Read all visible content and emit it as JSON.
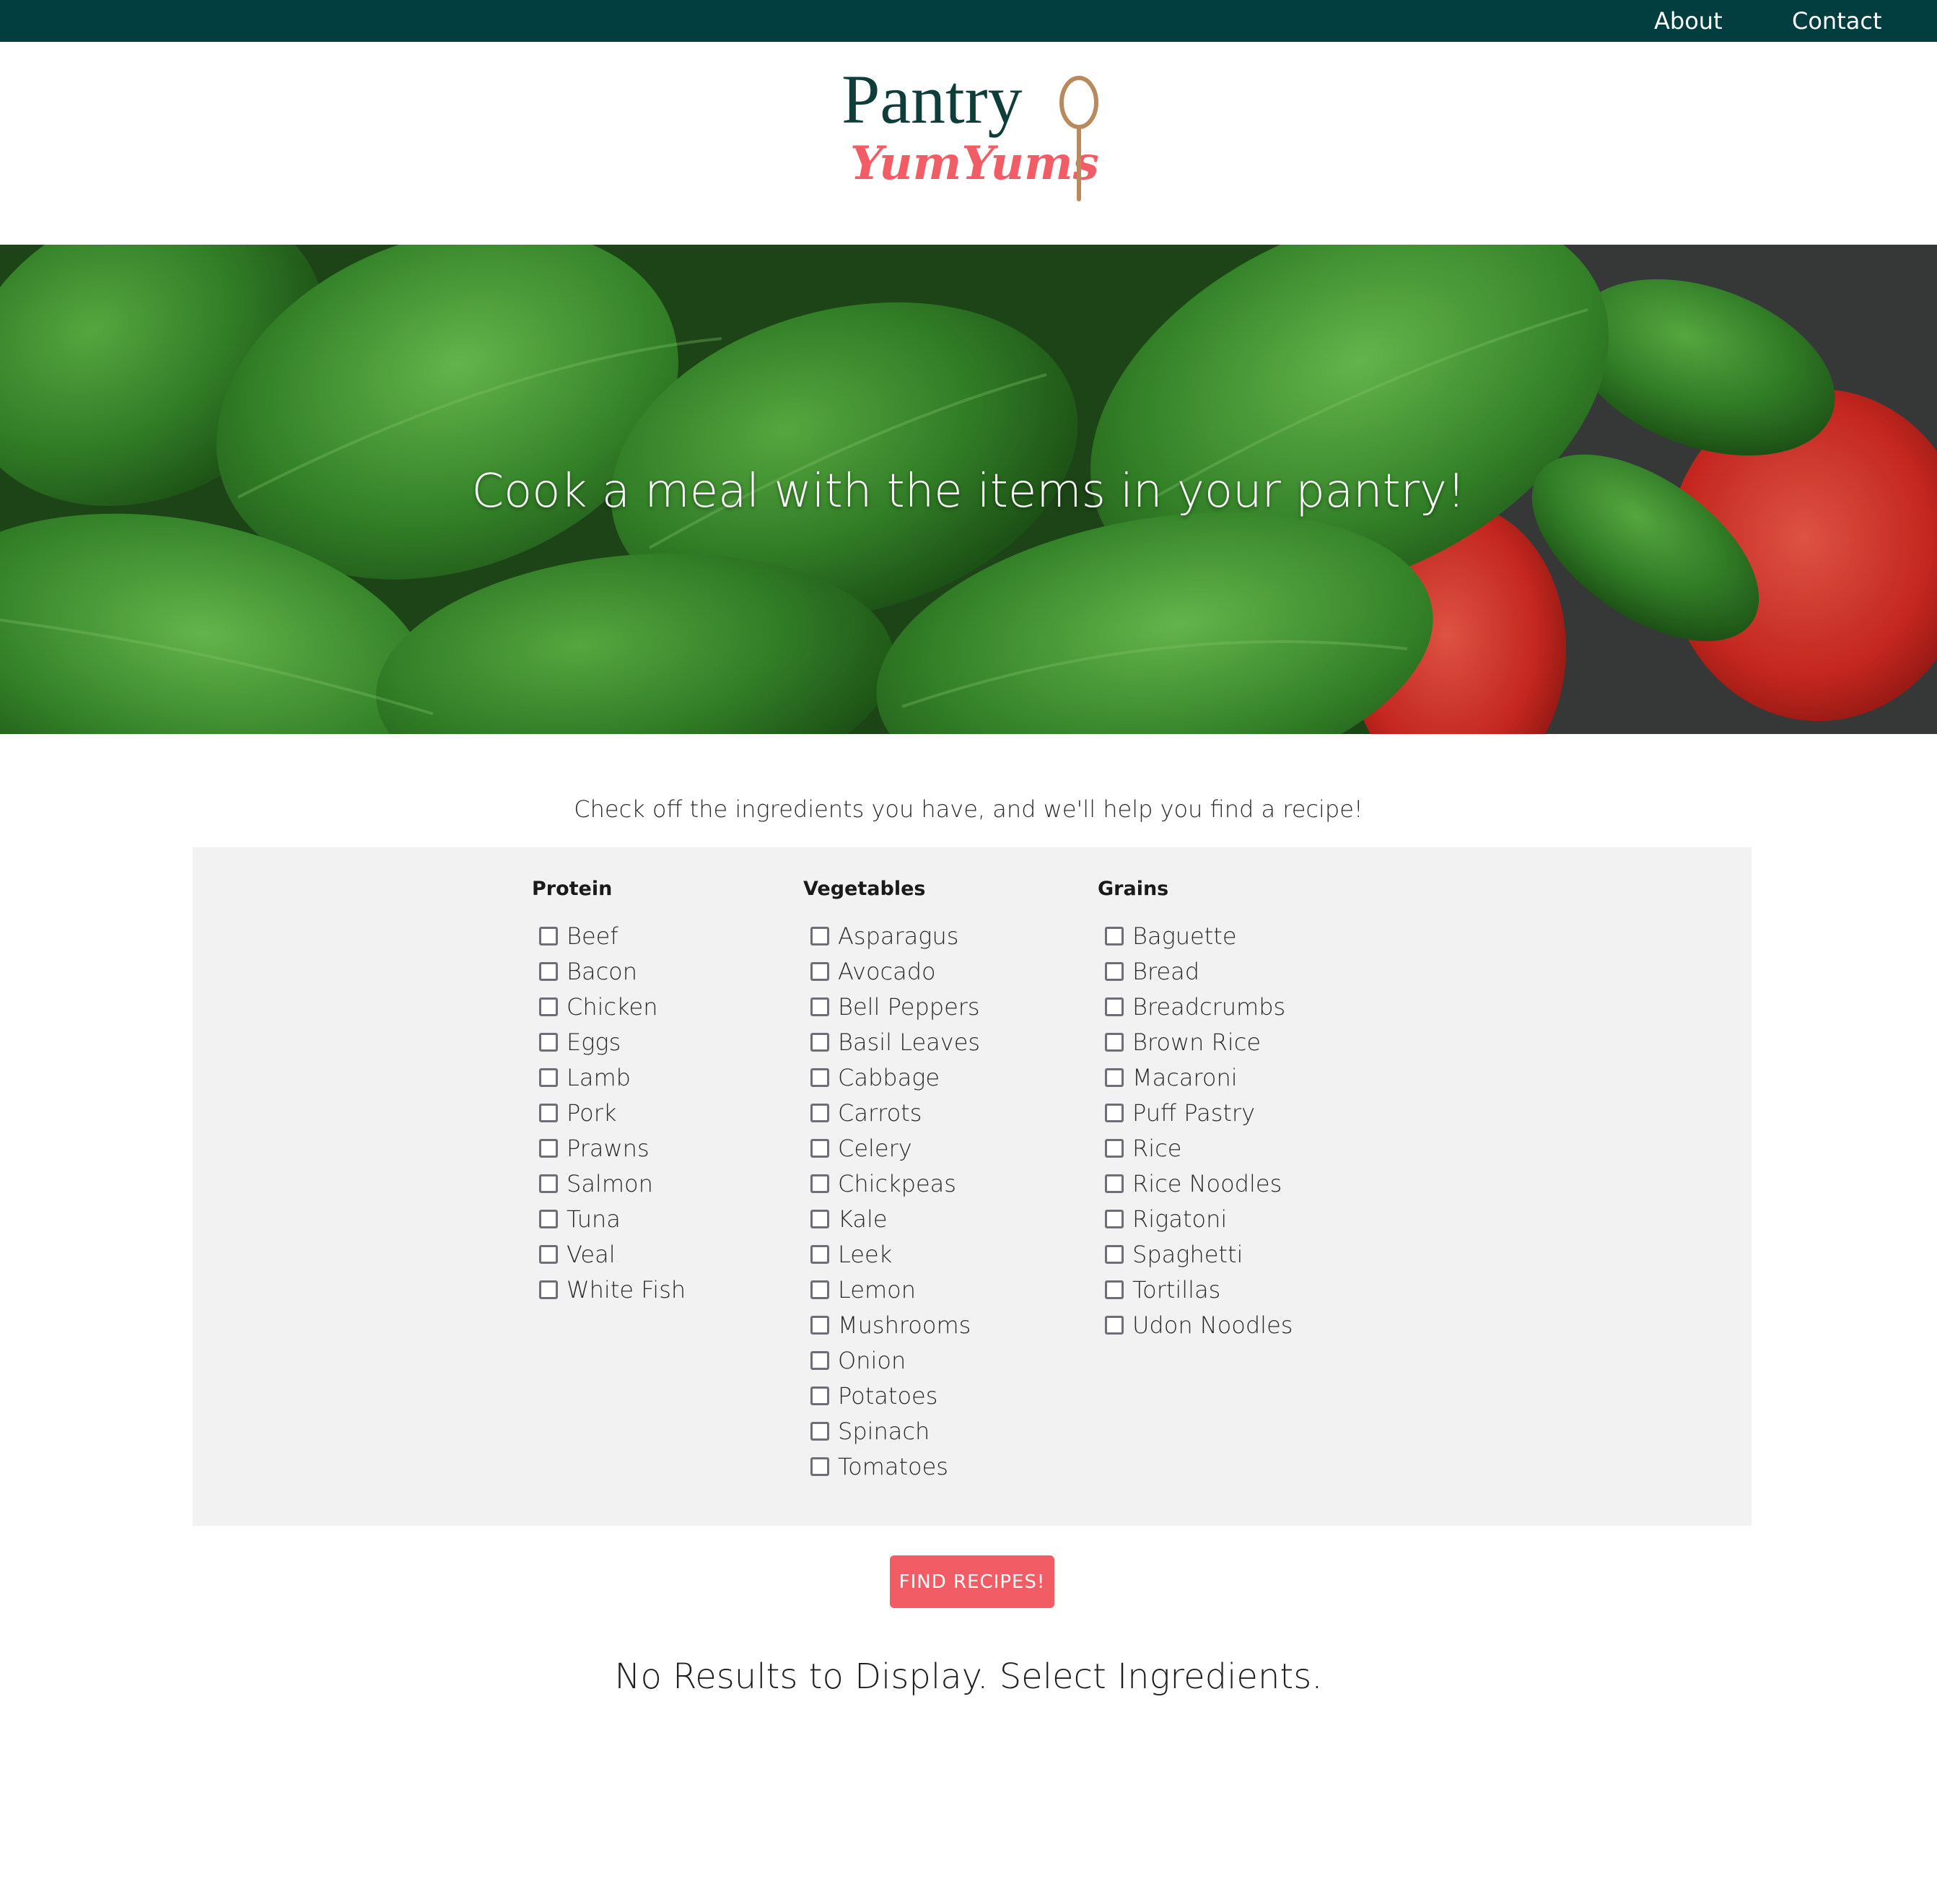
{
  "nav": {
    "about": "About",
    "contact": "Contact"
  },
  "logo": {
    "line1": "Pantry",
    "line2": "YumYums",
    "icon": "spoon-icon"
  },
  "hero": {
    "title": "Cook a meal with the items in your pantry!"
  },
  "instructions": "Check off the ingredients you have, and we'll help you find a recipe!",
  "categories": {
    "protein": {
      "heading": "Protein",
      "items": [
        "Beef",
        "Bacon",
        "Chicken",
        "Eggs",
        "Lamb",
        "Pork",
        "Prawns",
        "Salmon",
        "Tuna",
        "Veal",
        "White Fish"
      ]
    },
    "vegetables": {
      "heading": "Vegetables",
      "items": [
        "Asparagus",
        "Avocado",
        "Bell Peppers",
        "Basil Leaves",
        "Cabbage",
        "Carrots",
        "Celery",
        "Chickpeas",
        "Kale",
        "Leek",
        "Lemon",
        "Mushrooms",
        "Onion",
        "Potatoes",
        "Spinach",
        "Tomatoes"
      ]
    },
    "grains": {
      "heading": "Grains",
      "items": [
        "Baguette",
        "Bread",
        "Breadcrumbs",
        "Brown Rice",
        "Macaroni",
        "Puff Pastry",
        "Rice",
        "Rice Noodles",
        "Rigatoni",
        "Spaghetti",
        "Tortillas",
        "Udon Noodles"
      ]
    }
  },
  "find_button": "FIND RECIPES!",
  "no_results": "No Results to Display. Select Ingredients.",
  "colors": {
    "nav_bg": "#023d40",
    "logo_dark": "#0f3d3a",
    "logo_pink": "#f25d65",
    "spoon": "#b98a5e",
    "panel_bg": "#f2f2f2",
    "button": "#f25d65"
  }
}
